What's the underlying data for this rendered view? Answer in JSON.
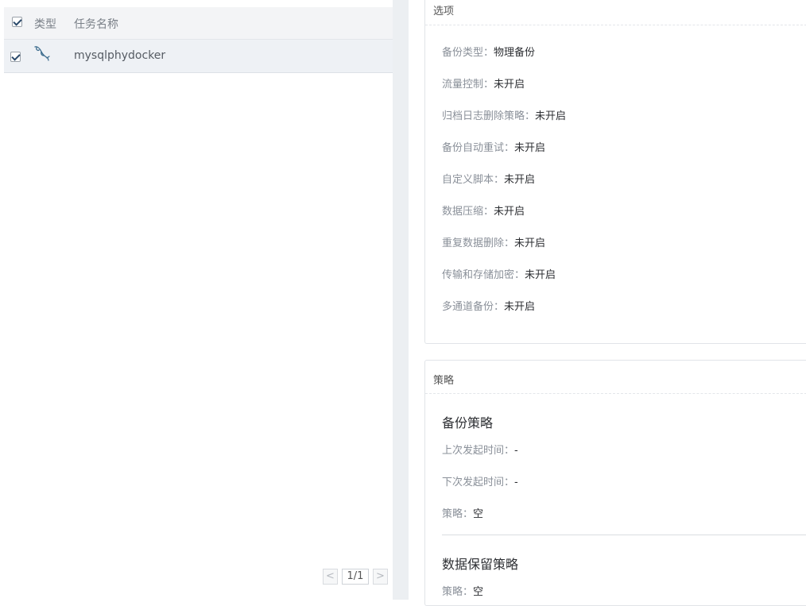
{
  "task_list": {
    "header": {
      "type_label": "类型",
      "name_label": "任务名称"
    },
    "rows": [
      {
        "icon": "mysql-dolphin-icon",
        "name": "mysqlphydocker"
      }
    ],
    "pager": {
      "prev": "<",
      "page": "1/1",
      "next": ">"
    }
  },
  "options": {
    "title": "选项",
    "items": [
      {
        "label": "备份类型：",
        "value": "物理备份"
      },
      {
        "label": "流量控制：",
        "value": "未开启"
      },
      {
        "label": "归档日志删除策略：",
        "value": "未开启"
      },
      {
        "label": "备份自动重试：",
        "value": "未开启"
      },
      {
        "label": "自定义脚本：",
        "value": "未开启"
      },
      {
        "label": "数据压缩：",
        "value": "未开启"
      },
      {
        "label": "重复数据删除：",
        "value": "未开启"
      },
      {
        "label": "传输和存储加密：",
        "value": "未开启"
      },
      {
        "label": "多通道备份：",
        "value": "未开启"
      }
    ]
  },
  "strategy": {
    "title": "策略",
    "backup": {
      "title": "备份策略",
      "items": [
        {
          "label": "上次发起时间：",
          "value": "-"
        },
        {
          "label": "下次发起时间：",
          "value": "-"
        },
        {
          "label": "策略：",
          "value": "空"
        }
      ]
    },
    "retention": {
      "title": "数据保留策略",
      "items": [
        {
          "label": "策略：",
          "value": "空"
        }
      ]
    }
  },
  "colors": {
    "accent": "#2b4a6b",
    "row_selected": "#eef1f5",
    "gutter": "#eceff2"
  }
}
